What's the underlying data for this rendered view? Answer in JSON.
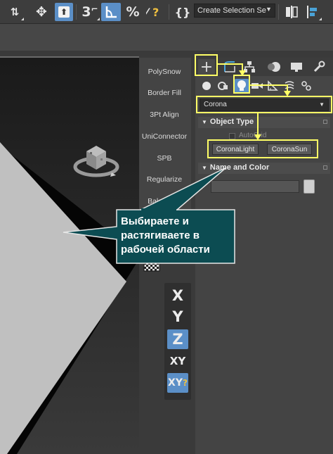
{
  "toolbar": {
    "selection_set_value": "Create Selection Se",
    "selection_set_arrow": "▼",
    "icons": [
      "select-and-link-icon",
      "select-and-move-icon",
      "select-by-name-icon",
      "snaps-toggle-3d-icon",
      "angle-snap-icon",
      "percent-snap-icon",
      "spinner-snap-icon",
      "edit-named-selection-icon",
      "mirror-icon",
      "align-icon"
    ],
    "labels": {
      "snap3d": "3",
      "percent": "%",
      "braces": "{}"
    }
  },
  "utility": {
    "items": [
      "PolySnow",
      "Border Fill",
      "3Pt Align",
      "UniConnector",
      "SPB",
      "Regularize",
      "BakeAnim"
    ]
  },
  "axis": {
    "items": [
      "X",
      "Y",
      "Z",
      "XY",
      "XY"
    ],
    "active_index": 2
  },
  "panel": {
    "tabs_icons": [
      "create-icon",
      "modify-icon",
      "hierarchy-icon",
      "motion-icon",
      "display-icon",
      "utilities-icon"
    ],
    "create_tab_label": "+",
    "category_icons": [
      "geometry-icon",
      "shapes-icon",
      "lights-icon",
      "cameras-icon",
      "helpers-icon",
      "space-warps-icon",
      "systems-icon"
    ],
    "dropdown_value": "Corona",
    "dropdown_arrow": "▼",
    "object_type_title": "Object Type",
    "autogrid_label": "AutoGrid",
    "buttons": [
      "CoronaLight",
      "CoronaSun"
    ],
    "name_color_title": "Name and Color",
    "name_value": "",
    "swatch_color": "#cfcfcf"
  },
  "callout": {
    "text": "Выбираете и\nрастягиваете в\nрабочей области",
    "background": "#0c4c52"
  },
  "colors": {
    "highlight": "#ffff66",
    "active_blue": "#5b8fc7"
  }
}
